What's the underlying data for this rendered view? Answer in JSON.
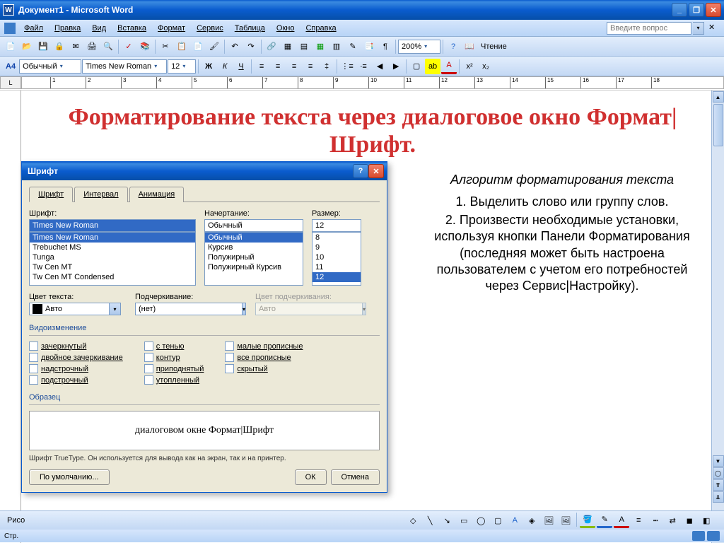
{
  "titlebar": {
    "app_icon": "W",
    "title": "Документ1 - Microsoft Word"
  },
  "menubar": {
    "items": [
      "Файл",
      "Правка",
      "Вид",
      "Вставка",
      "Формат",
      "Сервис",
      "Таблица",
      "Окно",
      "Справка"
    ],
    "help_placeholder": "Введите вопрос"
  },
  "toolbar1": {
    "zoom": "200%",
    "reading": "Чтение"
  },
  "toolbar2": {
    "style_label": "A4",
    "style": "Обычный",
    "font": "Times New Roman",
    "size": "12"
  },
  "page": {
    "title": "Форматирование текста через диалоговое окно Формат|Шрифт.",
    "algo_title": "Алгоритм форматирования текста",
    "step1": "1. Выделить слово или группу слов.",
    "step2": "2. Произвести необходимые установки, используя кнопки Панели Форматирования (последняя может быть настроена пользователем с учетом его потребностей через Сервис|Настройку)."
  },
  "dialog": {
    "title": "Шрифт",
    "tabs": [
      "Шрифт",
      "Интервал",
      "Анимация"
    ],
    "labels": {
      "font": "Шрифт:",
      "style": "Начертание:",
      "size": "Размер:",
      "color": "Цвет текста:",
      "underline": "Подчеркивание:",
      "underline_color": "Цвет подчеркивания:",
      "effects": "Видоизменение",
      "sample": "Образец"
    },
    "font_value": "Times New Roman",
    "font_list": [
      "Times New Roman",
      "Trebuchet MS",
      "Tunga",
      "Tw Cen MT",
      "Tw Cen MT Condensed"
    ],
    "style_value": "Обычный",
    "style_list": [
      "Обычный",
      "Курсив",
      "Полужирный",
      "Полужирный Курсив"
    ],
    "size_value": "12",
    "size_list": [
      "8",
      "9",
      "10",
      "11",
      "12"
    ],
    "color_value": "Авто",
    "underline_value": "(нет)",
    "underline_color_value": "Авто",
    "checks": {
      "col1": [
        "зачеркнутый",
        "двойное зачеркивание",
        "надстрочный",
        "подстрочный"
      ],
      "col2": [
        "с тенью",
        "контур",
        "приподнятый",
        "утопленный"
      ],
      "col3": [
        "малые прописные",
        "все прописные",
        "скрытый"
      ]
    },
    "preview_text": "диалоговом окне Формат|Шрифт",
    "hint": "Шрифт TrueType. Он используется для вывода как на экран, так и на принтер.",
    "buttons": {
      "default": "По умолчанию...",
      "ok": "ОК",
      "cancel": "Отмена"
    }
  },
  "drawbar": {
    "label": "Рисо"
  },
  "statusbar": {
    "text": "Стр."
  }
}
